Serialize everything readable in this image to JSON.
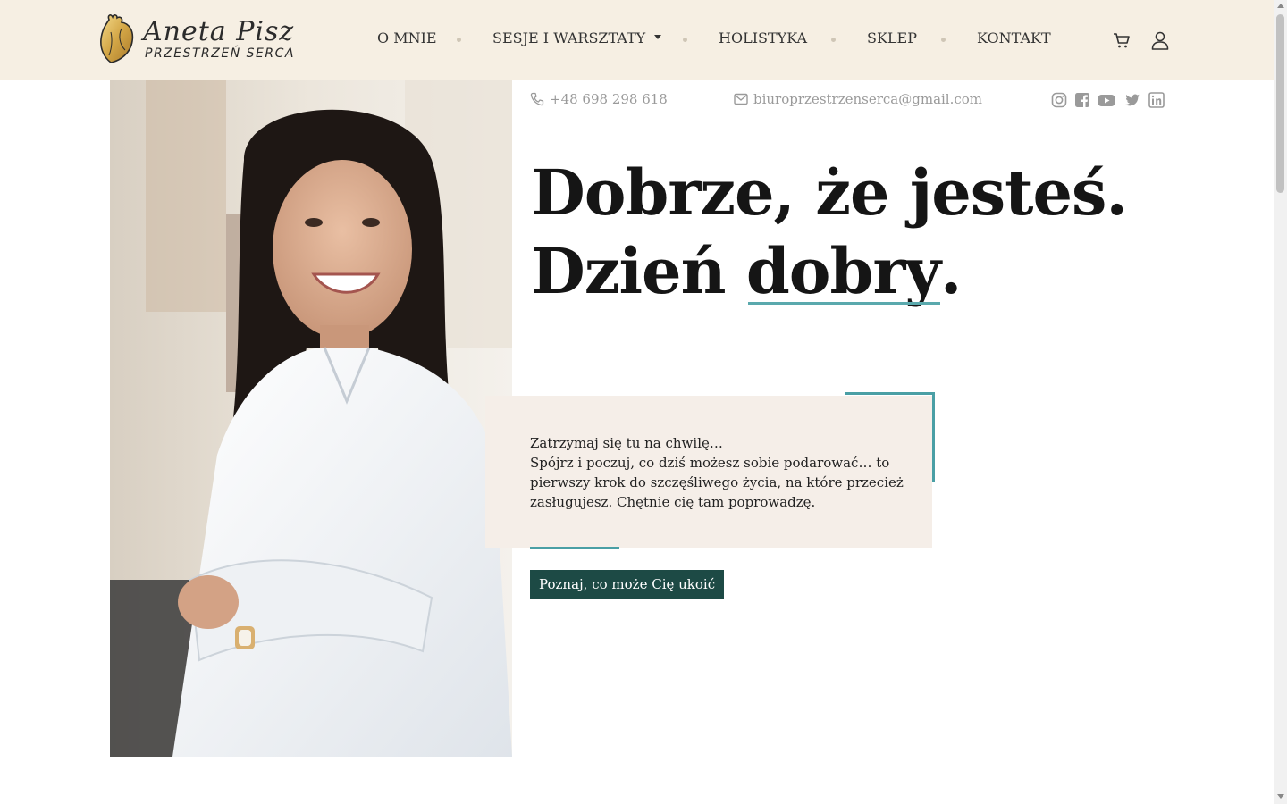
{
  "brand": {
    "name": "Aneta Pisz",
    "tagline": "PRZESTRZEŃ SERCA"
  },
  "nav": {
    "items": [
      {
        "label": "O MNIE"
      },
      {
        "label": "SESJE I WARSZTATY",
        "has_dropdown": true
      },
      {
        "label": "HOLISTYKA"
      },
      {
        "label": "SKLEP"
      },
      {
        "label": "KONTAKT"
      }
    ],
    "icons": [
      "cart-icon",
      "user-icon"
    ]
  },
  "contact": {
    "phone": "+48 698 298 618",
    "email": "biuroprzestrzenserca@gmail.com",
    "social_icons": [
      "instagram-icon",
      "facebook-icon",
      "youtube-icon",
      "twitter-icon",
      "linkedin-icon"
    ]
  },
  "hero": {
    "line1": "Dobrze, że jesteś.",
    "line2_prefix": "Dzień ",
    "line2_highlight": "dobry",
    "line2_suffix": ".",
    "intro_line1": "Zatrzymaj się tu na chwilę…",
    "intro_line2": "Spójrz i poczuj, co dziś możesz sobie podarować… to pierwszy krok do szczęśliwego życia, na które przecież zasługujesz. Chętnie cię tam poprowadzę.",
    "cta_label": "Poznaj, co może Cię ukoić"
  },
  "colors": {
    "header_bg": "#f6efe3",
    "accent_teal": "#4a9fa5",
    "cta_bg": "#1d4a45",
    "intro_bg": "#f5eee8",
    "contact_text": "#9a9a9a"
  }
}
